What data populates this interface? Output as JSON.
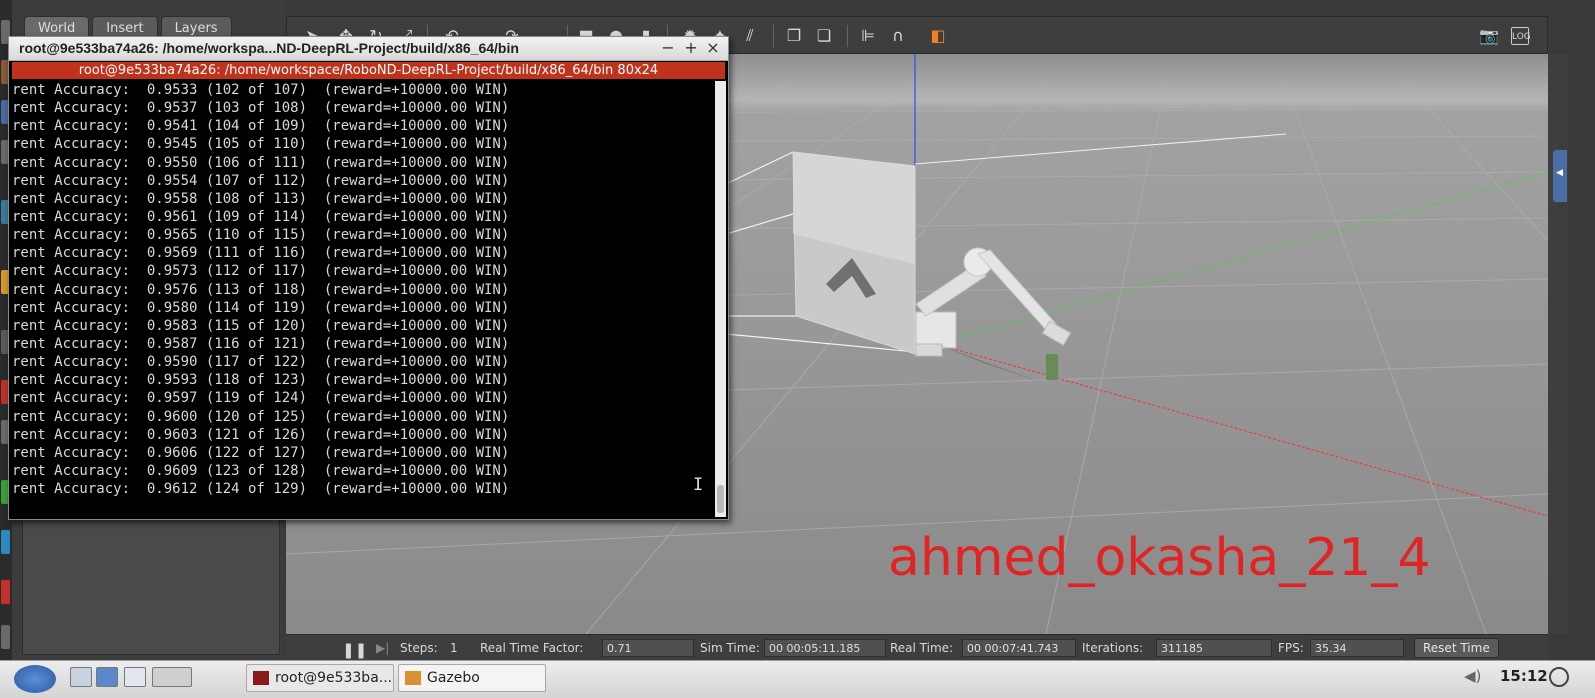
{
  "gazebo": {
    "tabs": [
      "World",
      "Insert",
      "Layers"
    ],
    "toolbar_icons": [
      "select-icon",
      "translate-icon",
      "rotate-icon",
      "scale-icon",
      "undo-icon",
      "redo-icon",
      "box-icon",
      "sphere-icon",
      "cylinder-icon",
      "point-light-icon",
      "spot-light-icon",
      "directional-light-icon",
      "copy-icon",
      "paste-icon",
      "align-icon",
      "snap-icon",
      "color-icon",
      "screenshot-icon",
      "log-icon"
    ],
    "status": {
      "steps_label": "Steps:",
      "steps_value": "1",
      "rtf_label": "Real Time Factor:",
      "rtf_value": "0.71",
      "sim_time_label": "Sim Time:",
      "sim_time_value": "00 00:05:11.185",
      "real_time_label": "Real Time:",
      "real_time_value": "00 00:07:41.743",
      "iterations_label": "Iterations:",
      "iterations_value": "311185",
      "fps_label": "FPS:",
      "fps_value": "35.34",
      "reset_label": "Reset Time"
    },
    "watermark": "ahmed_okasha_21_4"
  },
  "terminal": {
    "title": "root@9e533ba74a26: /home/workspa...ND-DeepRL-Project/build/x86_64/bin",
    "tab_title": "root@9e533ba74a26: /home/workspace/RoboND-DeepRL-Project/build/x86_64/bin 80x24",
    "controls": [
      "−",
      "+",
      "×"
    ],
    "lines": [
      "rent Accuracy:  0.9533 (102 of 107)  (reward=+10000.00 WIN)",
      "rent Accuracy:  0.9537 (103 of 108)  (reward=+10000.00 WIN)",
      "rent Accuracy:  0.9541 (104 of 109)  (reward=+10000.00 WIN)",
      "rent Accuracy:  0.9545 (105 of 110)  (reward=+10000.00 WIN)",
      "rent Accuracy:  0.9550 (106 of 111)  (reward=+10000.00 WIN)",
      "rent Accuracy:  0.9554 (107 of 112)  (reward=+10000.00 WIN)",
      "rent Accuracy:  0.9558 (108 of 113)  (reward=+10000.00 WIN)",
      "rent Accuracy:  0.9561 (109 of 114)  (reward=+10000.00 WIN)",
      "rent Accuracy:  0.9565 (110 of 115)  (reward=+10000.00 WIN)",
      "rent Accuracy:  0.9569 (111 of 116)  (reward=+10000.00 WIN)",
      "rent Accuracy:  0.9573 (112 of 117)  (reward=+10000.00 WIN)",
      "rent Accuracy:  0.9576 (113 of 118)  (reward=+10000.00 WIN)",
      "rent Accuracy:  0.9580 (114 of 119)  (reward=+10000.00 WIN)",
      "rent Accuracy:  0.9583 (115 of 120)  (reward=+10000.00 WIN)",
      "rent Accuracy:  0.9587 (116 of 121)  (reward=+10000.00 WIN)",
      "rent Accuracy:  0.9590 (117 of 122)  (reward=+10000.00 WIN)",
      "rent Accuracy:  0.9593 (118 of 123)  (reward=+10000.00 WIN)",
      "rent Accuracy:  0.9597 (119 of 124)  (reward=+10000.00 WIN)",
      "rent Accuracy:  0.9600 (120 of 125)  (reward=+10000.00 WIN)",
      "rent Accuracy:  0.9603 (121 of 126)  (reward=+10000.00 WIN)",
      "rent Accuracy:  0.9606 (122 of 127)  (reward=+10000.00 WIN)",
      "rent Accuracy:  0.9609 (123 of 128)  (reward=+10000.00 WIN)",
      "rent Accuracy:  0.9612 (124 of 129)  (reward=+10000.00 WIN)"
    ]
  },
  "taskbar": {
    "terminal_task": "root@9e533ba...",
    "gazebo_task": "Gazebo",
    "clock": "15:12"
  },
  "colors": {
    "terminal_bar": "#c0321c",
    "watermark": "#e02424",
    "x_axis": "#ff2a2a",
    "y_axis": "#3fd23f",
    "z_axis": "#2a4cff"
  }
}
